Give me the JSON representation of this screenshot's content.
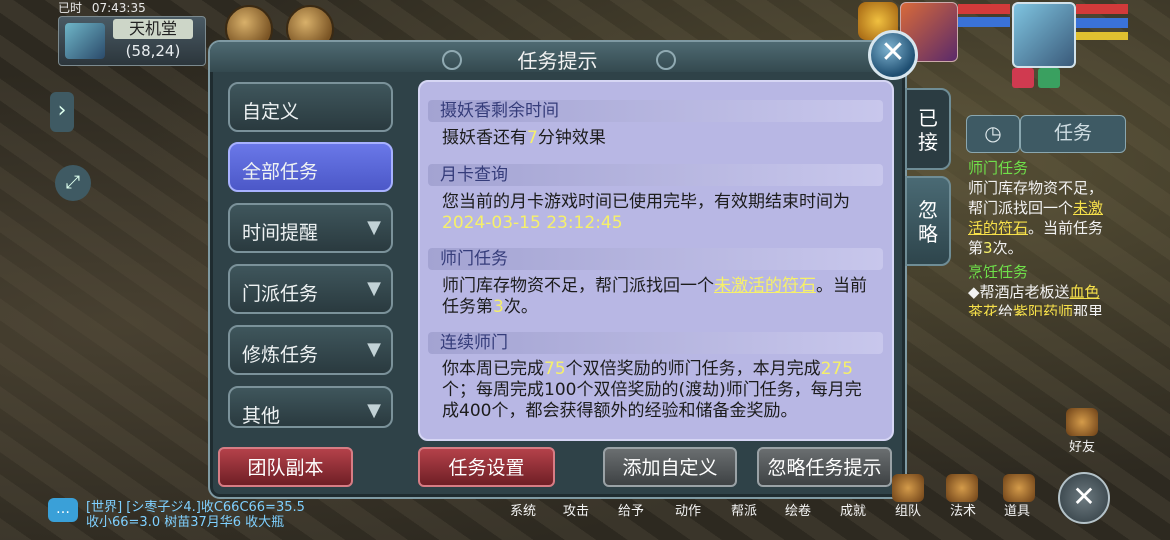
{
  "hud": {
    "status_tag": "已时",
    "time": "07:43:35",
    "location": "天机堂",
    "coords": "(58,24)"
  },
  "dialog": {
    "title": "任务提示",
    "close_label": "✕",
    "categories": [
      {
        "label": "自定义",
        "has_chevron": false,
        "active": false
      },
      {
        "label": "全部任务",
        "has_chevron": false,
        "active": true
      },
      {
        "label": "时间提醒",
        "has_chevron": true,
        "active": false
      },
      {
        "label": "门派任务",
        "has_chevron": true,
        "active": false
      },
      {
        "label": "修炼任务",
        "has_chevron": true,
        "active": false
      },
      {
        "label": "其他",
        "has_chevron": true,
        "active": false
      }
    ],
    "entries": [
      {
        "title": "摄妖香剩余时间",
        "body_pre": "摄妖香还有",
        "body_hl": "7",
        "body_post": "分钟效果"
      },
      {
        "title": "月卡查询",
        "body_pre": "您当前的月卡游戏时间已使用完毕，有效期结束时间为",
        "body_hl": "2024-03-15 23:12:45",
        "body_post": ""
      },
      {
        "title": "师门任务",
        "body_pre": "师门库存物资不足，帮门派找回一个",
        "body_link": "未激活的符石",
        "body_mid": "。当前任务第",
        "body_hl": "3",
        "body_post": "次。"
      },
      {
        "title": "连续师门",
        "body_pre": "你本周已完成",
        "hl1": "75",
        "mid1": "个双倍奖励的师门任务，本月完成",
        "hl2": "275",
        "body_post": "个；每周完成100个双倍奖励的(渡劫)师门任务，每月完成400个，都会获得额外的经验和储备金奖励。"
      }
    ],
    "tabs": {
      "accepted": "已接",
      "ignore": "忽略"
    },
    "buttons": {
      "team_dungeon": "团队副本",
      "task_settings": "任务设置",
      "add_custom": "添加自定义",
      "ignore_hints": "忽略任务提示"
    }
  },
  "side": {
    "timer_icon": "clock-icon",
    "task_button": "任务",
    "task1_title": "师门任务",
    "task1_pre": "师门库存物资不足，帮门派找回一个",
    "task1_link": "未激活的符石",
    "task1_mid": "。当前任务第",
    "task1_num": "3",
    "task1_post": "次。",
    "task2_title": "烹饪任务",
    "task2_pre": "◆帮酒店老板送",
    "task2_link1": "血色茶花",
    "task2_mid": "给",
    "task2_link2": "紫阳药师",
    "task2_post": "那里"
  },
  "bottom": {
    "friend_label": "好友",
    "menu": [
      "系统",
      "攻击",
      "给予",
      "动作",
      "帮派",
      "绘卷",
      "成就",
      "组队",
      "法术",
      "道具"
    ],
    "chat_line1": "[世界] [シ枣子ジ4.]收C66C66=35.5",
    "chat_line2": "收小66=3.0  树苗37月华6  收大瓶"
  },
  "colors": {
    "accent_active": "#5864d8",
    "panel_bg": "#b8b7e4",
    "highlight": "#f6f06a",
    "button_red": "#9a343c"
  }
}
